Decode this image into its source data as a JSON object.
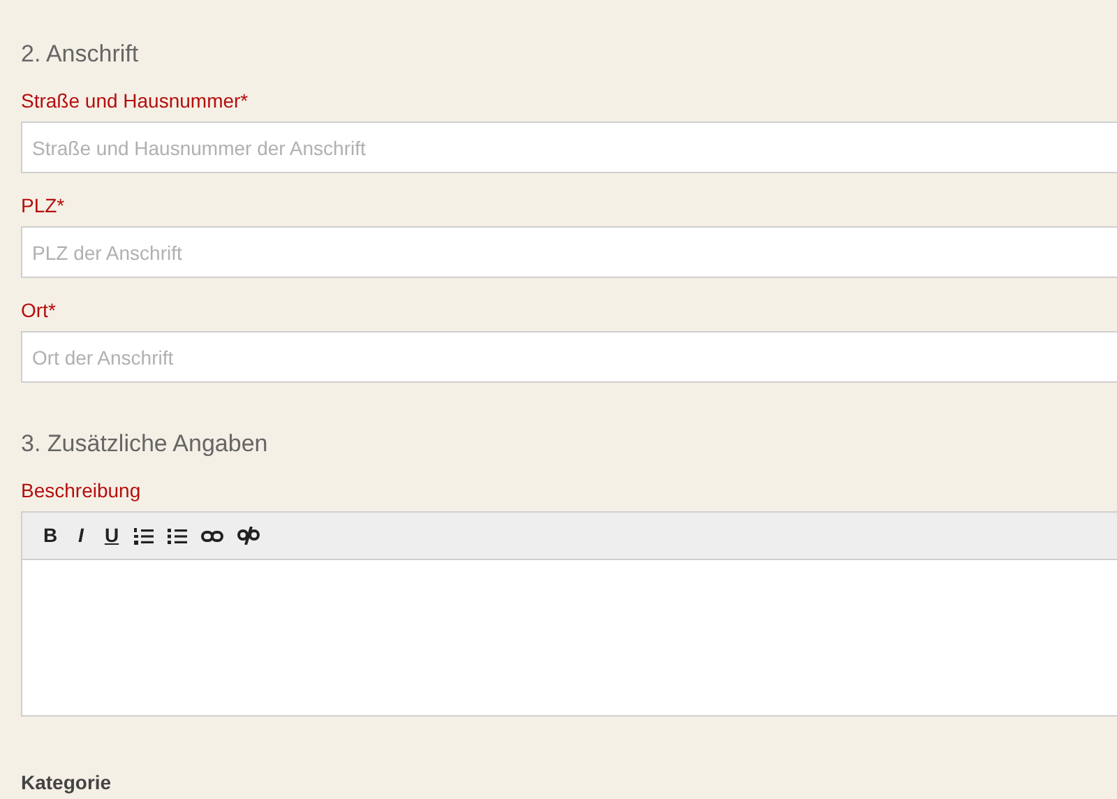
{
  "sections": [
    {
      "heading": "2. Anschrift",
      "fields": [
        {
          "kind": "input",
          "label": "Straße und Hausnummer*",
          "required": true,
          "placeholder": "Straße und Hausnummer der Anschrift"
        },
        {
          "kind": "input",
          "label": "PLZ*",
          "required": true,
          "placeholder": "PLZ der Anschrift"
        },
        {
          "kind": "input",
          "label": "Ort*",
          "required": true,
          "placeholder": "Ort der Anschrift"
        }
      ]
    },
    {
      "heading": "3. Zusätzliche Angaben",
      "fields": [
        {
          "kind": "editor",
          "label": "Beschreibung",
          "required": true,
          "toolbar": [
            {
              "kind": "bold",
              "label": "B"
            },
            {
              "kind": "italic",
              "label": "I"
            },
            {
              "kind": "underline",
              "label": "U"
            },
            {
              "kind": "ordered-list"
            },
            {
              "kind": "bullet-list"
            },
            {
              "kind": "link"
            },
            {
              "kind": "unlink"
            }
          ]
        },
        {
          "kind": "group",
          "label": "Kategorie",
          "required": false
        }
      ]
    }
  ]
}
